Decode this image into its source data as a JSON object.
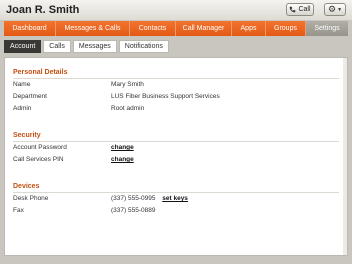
{
  "header": {
    "user_name": "Joan R. Smith",
    "call_label": "Call"
  },
  "nav": {
    "items": [
      "Dashboard",
      "Messages & Calls",
      "Contacts",
      "Call Manager",
      "Apps",
      "Groups",
      "Settings"
    ],
    "active": "Settings"
  },
  "subnav": {
    "items": [
      "Account",
      "Calls",
      "Messages",
      "Notifications"
    ],
    "active": "Account"
  },
  "personal": {
    "title": "Personal Details",
    "name_label": "Name",
    "name_value": "Mary Smith",
    "department_label": "Department",
    "department_value": "LUS Fiber Business Support Services",
    "admin_label": "Admin",
    "admin_value": "Root admin"
  },
  "security": {
    "title": "Security",
    "password_label": "Account Password",
    "password_link": "change",
    "pin_label": "Call Services PIN",
    "pin_link": "change"
  },
  "devices": {
    "title": "Devices",
    "desk_label": "Desk Phone",
    "desk_value": "(337) 555-0995",
    "desk_link": "set keys",
    "fax_label": "Fax",
    "fax_value": "(337) 555-0889"
  },
  "colors": {
    "accent": "#e8621f",
    "active_tab": "#a29f97",
    "section_title": "#c45013"
  }
}
